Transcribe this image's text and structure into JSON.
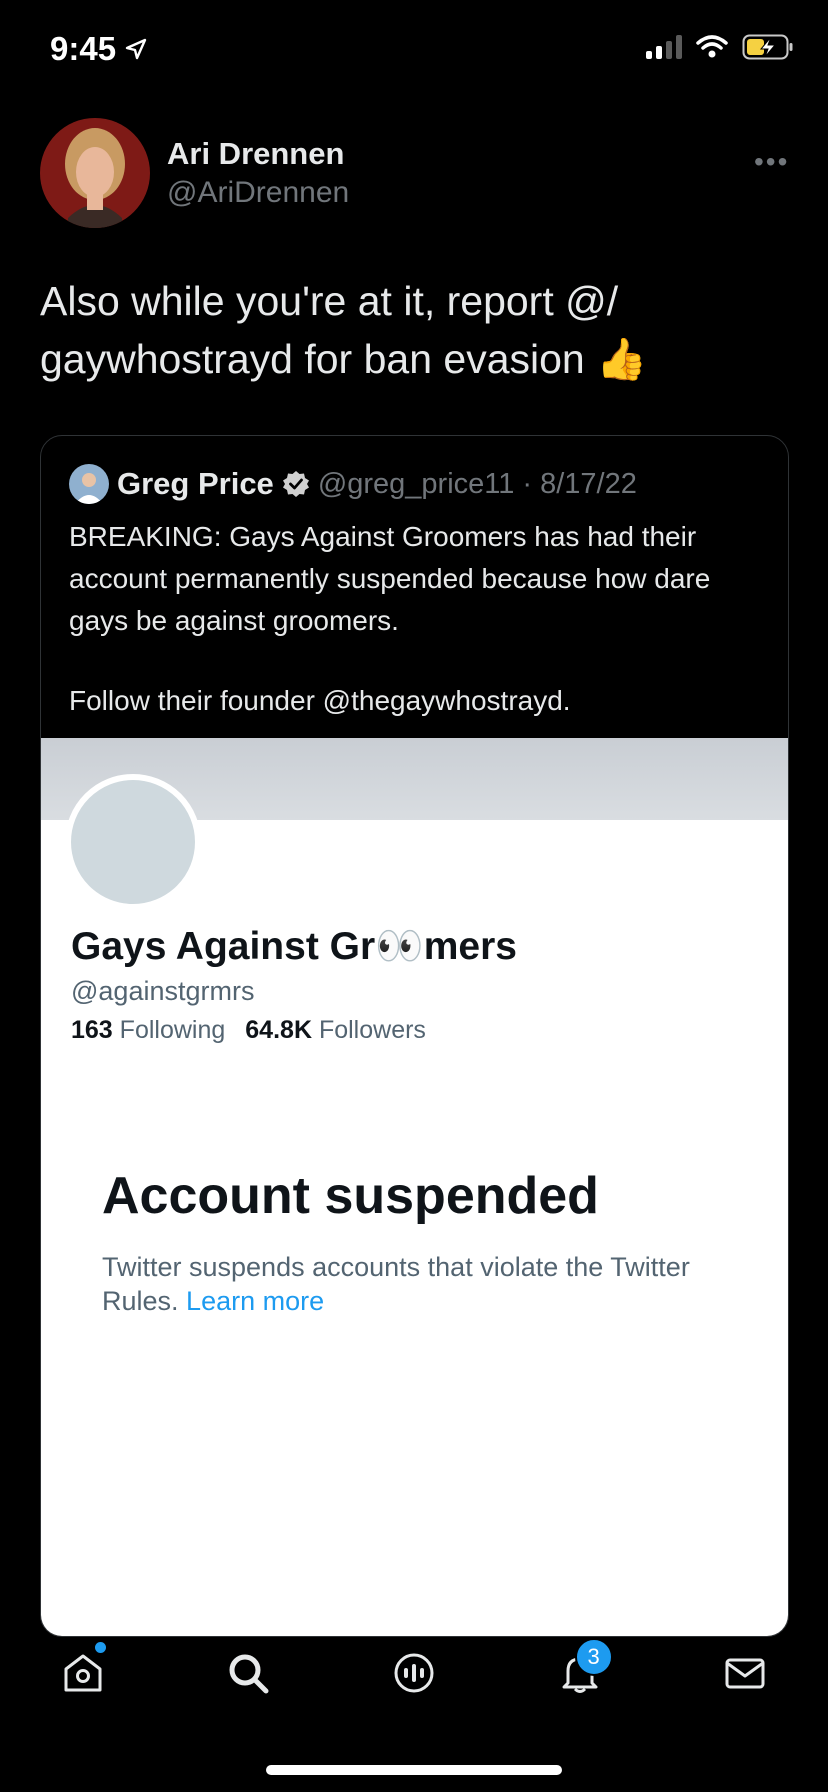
{
  "status_bar": {
    "time": "9:45"
  },
  "tweet": {
    "author_name": "Ari Drennen",
    "author_handle": "@AriDrennen",
    "more_icon": "more-dots-icon",
    "text": "Also while you're at it, report @/ gaywhostrayd for ban evasion 👍"
  },
  "quote": {
    "author_name": "Greg Price",
    "author_handle": "@greg_price11",
    "date": "· 8/17/22",
    "text_line1": "BREAKING: Gays Against Groomers has had their account permanently suspended because how dare gays be against groomers.",
    "text_line2": "Follow their founder @thegaywhostrayd.",
    "screenshot": {
      "profile_name": "Gays Against Gr👀mers",
      "profile_handle": "@againstgrmrs",
      "following_count": "163",
      "following_label": "Following",
      "followers_count": "64.8K",
      "followers_label": "Followers",
      "suspended_title": "Account suspended",
      "suspended_body": "Twitter suspends accounts that violate the Twitter Rules.",
      "learn_more": "Learn more"
    }
  },
  "tabbar": {
    "items": [
      {
        "icon": "home-icon"
      },
      {
        "icon": "search-icon"
      },
      {
        "icon": "spaces-icon"
      },
      {
        "icon": "notifications-icon",
        "badge": "3"
      },
      {
        "icon": "messages-icon"
      }
    ]
  },
  "colors": {
    "accent": "#1d9bf0",
    "background": "#000000"
  }
}
